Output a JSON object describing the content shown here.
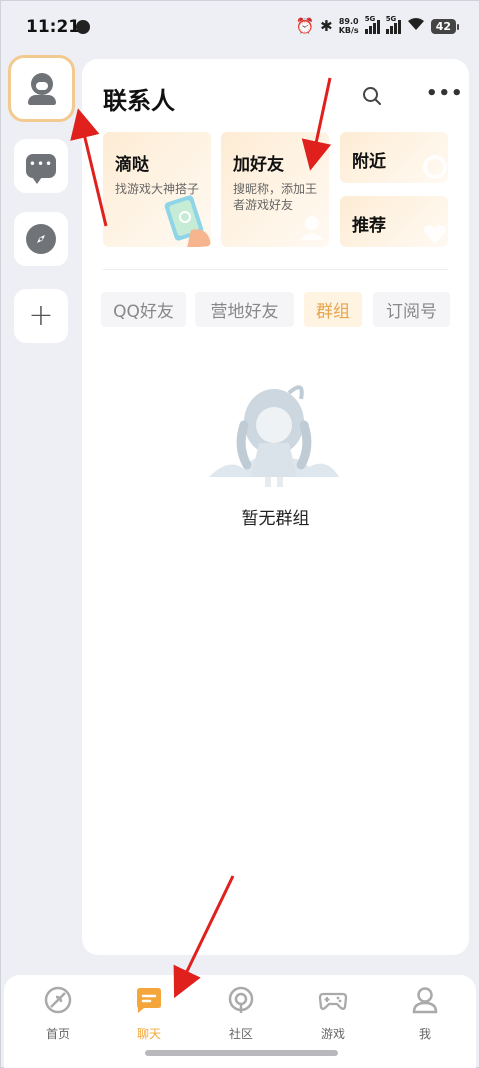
{
  "status_bar": {
    "time": "11:21",
    "net_speed_value": "89.0",
    "net_speed_unit": "KB/s",
    "signal1_label": "5G",
    "signal2_label": "5G",
    "battery": "42"
  },
  "rail": {
    "items": [
      {
        "name": "contacts",
        "icon": "contacts-icon",
        "active": true
      },
      {
        "name": "messages",
        "icon": "chat-icon",
        "active": false
      },
      {
        "name": "discover",
        "icon": "compass-icon",
        "active": false
      },
      {
        "name": "add",
        "icon": "plus-icon",
        "active": false
      }
    ]
  },
  "header": {
    "title": "联系人",
    "search_icon": "search-icon",
    "more_icon": "more-icon"
  },
  "cards": {
    "didi": {
      "title": "滴哒",
      "subtitle": "找游戏大神搭子"
    },
    "add_friend": {
      "title": "加好友",
      "subtitle": "搜昵称，添加王者游戏好友"
    },
    "nearby": {
      "title": "附近"
    },
    "recommend": {
      "title": "推荐"
    }
  },
  "tabs": [
    {
      "label": "QQ好友",
      "active": false
    },
    {
      "label": "营地好友",
      "active": false
    },
    {
      "label": "群组",
      "active": true
    },
    {
      "label": "订阅号",
      "active": false
    }
  ],
  "empty_state": {
    "text": "暂无群组"
  },
  "bottom_nav": [
    {
      "label": "首页",
      "icon": "home-icon",
      "active": false
    },
    {
      "label": "聊天",
      "icon": "chat-icon",
      "active": true
    },
    {
      "label": "社区",
      "icon": "community-icon",
      "active": false
    },
    {
      "label": "游戏",
      "icon": "gamepad-icon",
      "active": false
    },
    {
      "label": "我",
      "icon": "profile-icon",
      "active": false
    }
  ],
  "colors": {
    "accent": "#f5a63b",
    "annotation_arrow": "#e0201c",
    "background": "#eeeff4"
  }
}
